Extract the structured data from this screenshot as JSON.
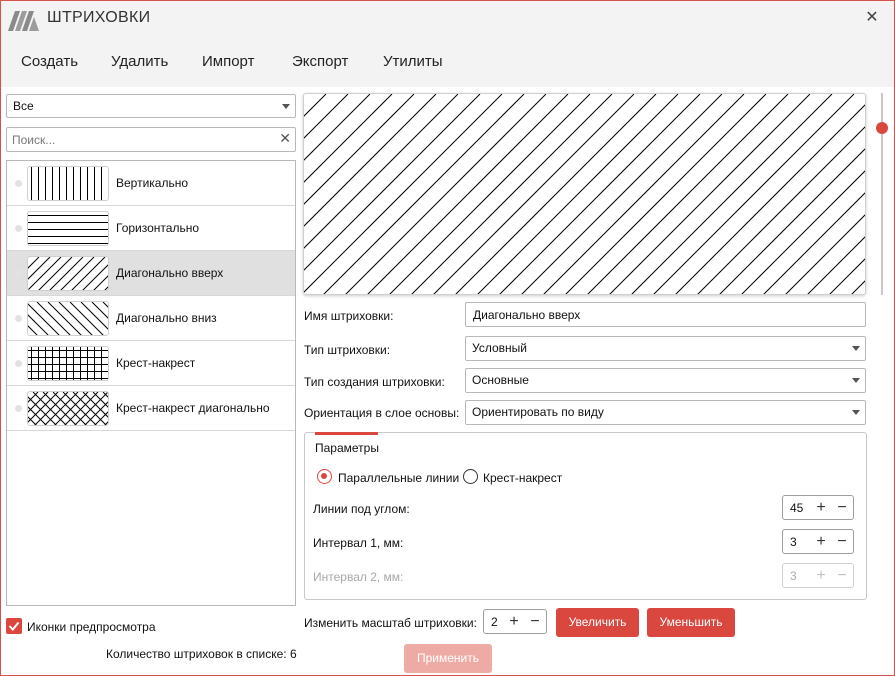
{
  "window": {
    "title": "ШТРИХОВКИ"
  },
  "menu": [
    "Создать",
    "Удалить",
    "Импорт",
    "Экспорт",
    "Утилиты"
  ],
  "filter": {
    "selected": "Все"
  },
  "search": {
    "placeholder": "Поиск..."
  },
  "hatches": [
    {
      "label": "Вертикально",
      "pattern": "vertical",
      "selected": false
    },
    {
      "label": "Горизонтально",
      "pattern": "horizontal",
      "selected": false
    },
    {
      "label": "Диагонально вверх",
      "pattern": "diag-up",
      "selected": true
    },
    {
      "label": "Диагонально вниз",
      "pattern": "diag-down",
      "selected": false
    },
    {
      "label": "Крест-накрест",
      "pattern": "cross",
      "selected": false
    },
    {
      "label": "Крест-накрест диагонально",
      "pattern": "cross-diag",
      "selected": false
    }
  ],
  "preview_icons": {
    "label": "Иконки предпросмотра",
    "checked": true
  },
  "count_label": "Количество штриховок в списке: 6",
  "form": {
    "name_label": "Имя штриховки:",
    "name_value": "Диагонально вверх",
    "type_label": "Тип штриховки:",
    "type_value": "Условный",
    "create_label": "Тип создания штриховки:",
    "create_value": "Основные",
    "orient_label": "Ориентация в слое основы:",
    "orient_value": "Ориентировать по виду"
  },
  "params": {
    "title": "Параметры",
    "radio_parallel": "Параллельные линии",
    "radio_cross": "Крест-накрест",
    "selected": "parallel",
    "angle_label": "Линии под углом:",
    "angle_value": "45",
    "interval1_label": "Интервал 1, мм:",
    "interval1_value": "3",
    "interval2_label": "Интервал 2, мм:",
    "interval2_value": "3"
  },
  "scale": {
    "label": "Изменить масштаб штриховки:",
    "value": "2",
    "increase": "Увеличить",
    "decrease": "Уменьшить"
  },
  "apply_label": "Применить",
  "colors": {
    "accent": "#d9473f",
    "accent_disabled": "#eeaba6",
    "chrome": "#f3f3f3",
    "selected_row": "#e0e0e0"
  }
}
